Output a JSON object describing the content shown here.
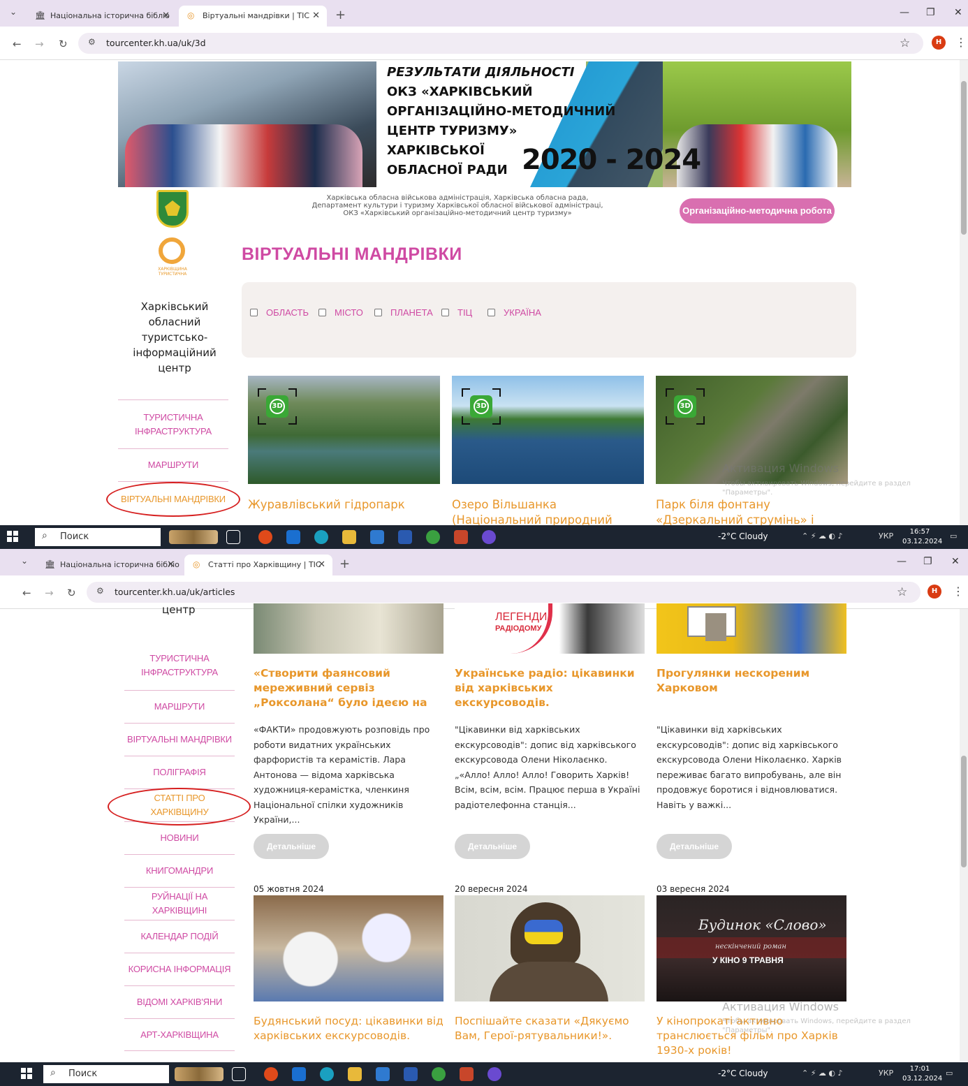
{
  "shot1": {
    "tabs": [
      {
        "label": "Національна історична бібліо",
        "active": false
      },
      {
        "label": "Віртуальні мандрівки | ТІС",
        "active": true
      }
    ],
    "url": "tourcenter.kh.ua/uk/3d",
    "banner": {
      "line1": "РЕЗУЛЬТАТИ ДІЯЛЬНОСТІ",
      "line2": "ОКЗ «ХАРКІВСЬКИЙ",
      "line3": "ОРГАНІЗАЦІЙНО-МЕТОДИЧНИЙ",
      "line4": "ЦЕНТР ТУРИЗМУ» ХАРКІВСЬКОЇ",
      "line5": "ОБЛАСНОЇ РАДИ",
      "years": "2020 - 2024"
    },
    "org_line1": "Харківська обласна військова адміністрація, Харківська обласна рада,",
    "org_line2": "Департамент культури і туризму Харківської обласної військової адміністраці,",
    "org_line3": "ОКЗ «Харківський організаційно-методичний центр туризму»",
    "org_button": "Організаційно-методична робота",
    "logo_caption": "ХАРКІВЩИНА ТУРИСТИЧНА",
    "section_title": "ВІРТУАЛЬНІ МАНДРІВКИ",
    "filters": [
      "ОБЛАСТЬ",
      "МІСТО",
      "ПЛАНЕТА",
      "ТІЦ",
      "УКРАЇНА"
    ],
    "org_name": "Харківський обласний туристсько-інформаційний центр",
    "menu": [
      "ТУРИСТИЧНА ІНФРАСТРУКТУРА",
      "МАРШРУТИ",
      "ВІРТУАЛЬНІ МАНДРІВКИ"
    ],
    "badge": "3D",
    "tours": [
      {
        "title": "Журавлівський гідропарк"
      },
      {
        "title": "Озеро Вільшанка (Національний природний"
      },
      {
        "title": "Парк біля фонтану «Дзеркальний струмінь» і"
      }
    ],
    "watermark_title": "Активация Windows",
    "watermark_text": "Чтобы активировать Windows, перейдите в раздел \"Параметры\".",
    "taskbar": {
      "search": "Поиск",
      "weather": "-2°C Cloudy",
      "lang": "УКР",
      "time": "16:57",
      "date": "03.12.2024"
    }
  },
  "shot2": {
    "tabs": [
      {
        "label": "Національна історична бібліо",
        "active": false
      },
      {
        "label": "Статті про Харківщину | ТІС",
        "active": true
      }
    ],
    "url": "tourcenter.kh.ua/uk/articles",
    "org_tail": "центр",
    "menu": [
      "ТУРИСТИЧНА ІНФРАСТРУКТУРА",
      "МАРШРУТИ",
      "ВІРТУАЛЬНІ МАНДРІВКИ",
      "ПОЛІГРАФІЯ",
      "СТАТТІ ПРО ХАРКІВЩИНУ",
      "НОВИНИ",
      "КНИГОМАНДРИ",
      "РУЙНАЦІЇ НА ХАРКІВЩИНІ",
      "КАЛЕНДАР ПОДІЙ",
      "КОРИСНА ІНФОРМАЦІЯ",
      "ВІДОМІ ХАРКІВ'ЯНИ",
      "АРТ-ХАРКІВЩИНА"
    ],
    "articles": [
      {
        "title": "«Створити фаянсовий мереживний сервіз „Роксолана“ було ідеєю на",
        "text": "«ФАКТИ» продовжують розповідь про роботи видатних українських фарфористів та керамістів. Лара Антонова — відома харківська художниця-керамістка, членкиня Національної спілки художників України,...",
        "button": "Детальніше"
      },
      {
        "title": "Українське радіо: цікавинки від харківських екскурсоводів.",
        "text": "\"Цікавинки від харківських екскурсоводів\": допис від харківського екскурсовода Олени Ніколаєнко. „«Алло! Алло! Алло! Говорить Харків! Всім, всім, всім. Працює перша в Україні радіотелефонна станція...",
        "button": "Детальніше",
        "img_label1": "ЛЕГЕНДИ",
        "img_label2": "РАДІОДОМУ"
      },
      {
        "title": "Прогулянки нескореним Харковом",
        "text": "\"Цікавинки від харківських екскурсоводів\": допис від харківського екскурсовода Олени Ніколаєнко. Харків переживає багато випробувань, але він продовжує боротися і відновлюватися. Навіть у важкі...",
        "button": "Детальніше"
      }
    ],
    "articles2": [
      {
        "date": "05 жовтня 2024",
        "title": "Будянський посуд: цікавинки від харківських екскурсоводів."
      },
      {
        "date": "20 вересня 2024",
        "title": "Поспішайте сказати «Дякуємо Вам, Герої-рятувальники!»."
      },
      {
        "date": "03 вересня 2024",
        "title": "У кінопрокаті активно транслюється фільм про Харків 1930-х років!",
        "poster_title": "Будинок «Слово»",
        "poster_sub": "нескінчений роман",
        "poster_date": "У КІНО 9 ТРАВНЯ"
      }
    ],
    "watermark_title": "Активация Windows",
    "watermark_text": "Чтобы активировать Windows, перейдите в раздел \"Параметры\".",
    "taskbar": {
      "search": "Поиск",
      "weather": "-2°C Cloudy",
      "lang": "УКР",
      "time": "17:01",
      "date": "03.12.2024"
    }
  },
  "colors": {
    "accent_pink": "#cf4aa3",
    "accent_orange": "#e8972b",
    "highlight_red": "#d62020"
  }
}
